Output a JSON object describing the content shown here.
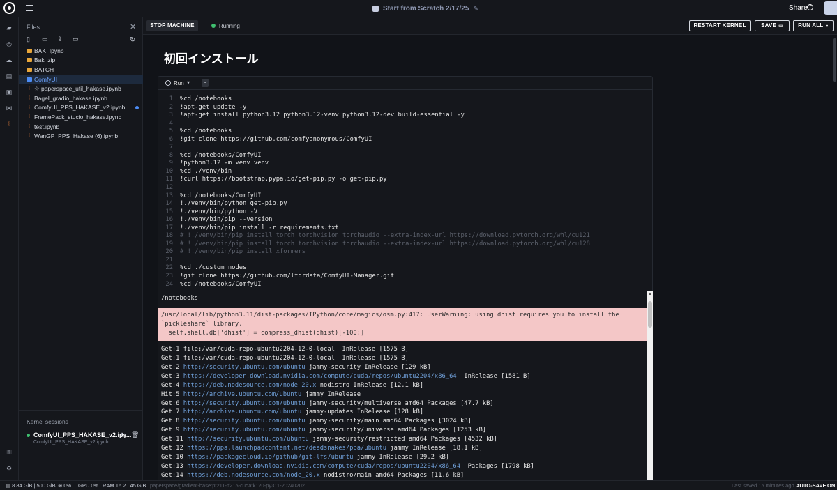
{
  "topbar": {
    "title": "Start from Scratch 2/17/25",
    "share_label": "Share",
    "help_glyph": "?"
  },
  "rail_icons": [
    "folder-icon",
    "globe-icon",
    "cloud-icon",
    "notebook-icon",
    "terminal-icon",
    "vscode-icon",
    "jupyter-icon"
  ],
  "files": {
    "header": "Files",
    "items": [
      {
        "label": "BAK_Ipynb",
        "type": "folder"
      },
      {
        "label": "Bak_zip",
        "type": "folder"
      },
      {
        "label": "BATCH",
        "type": "folder"
      },
      {
        "label": "ComfyUI",
        "type": "folder",
        "active": true
      },
      {
        "label": "☆ paperspace_util_hakase.ipynb",
        "type": "notebook"
      },
      {
        "label": "Bagel_gradio_hakase.ipynb",
        "type": "notebook"
      },
      {
        "label": "ComfyUI_PPS_HAKASE_v2.ipynb",
        "type": "notebook",
        "modified": true
      },
      {
        "label": "FramePack_stucio_hakase.ipynb",
        "type": "notebook"
      },
      {
        "label": "test.ipynb",
        "type": "notebook"
      },
      {
        "label": "WanGP_PPS_Hakase (6).ipynb",
        "type": "notebook"
      }
    ]
  },
  "kernel_sessions": {
    "header": "Kernel sessions",
    "name": "ComfyUI_PPS_HAKASE_v2.ipy...",
    "file": "ComfyUI_PPS_HAKASE_v2.ipynb"
  },
  "toolbar": {
    "stop_label": "STOP MACHINE",
    "status": "Running",
    "restart_label": "RESTART KERNEL",
    "save_label": "SAVE",
    "run_all_label": "RUN ALL"
  },
  "notebook": {
    "title": "初回インストール",
    "run_label": "Run",
    "more_glyph": "⌄",
    "code": [
      {
        "n": "1",
        "text": "%cd /notebooks"
      },
      {
        "n": "2",
        "text": "!apt-get update -y"
      },
      {
        "n": "3",
        "text": "!apt-get install python3.12 python3.12-venv python3.12-dev build-essential -y"
      },
      {
        "n": "4",
        "text": ""
      },
      {
        "n": "5",
        "text": "%cd /notebooks"
      },
      {
        "n": "6",
        "text": "!git clone https://github.com/comfyanonymous/ComfyUI"
      },
      {
        "n": "7",
        "text": ""
      },
      {
        "n": "8",
        "text": "%cd /notebooks/ComfyUI"
      },
      {
        "n": "9",
        "text": "!python3.12 -m venv venv"
      },
      {
        "n": "10",
        "text": "%cd ./venv/bin"
      },
      {
        "n": "11",
        "text": "!curl https://bootstrap.pypa.io/get-pip.py -o get-pip.py"
      },
      {
        "n": "12",
        "text": ""
      },
      {
        "n": "13",
        "text": "%cd /notebooks/ComfyUI"
      },
      {
        "n": "14",
        "text": "!./venv/bin/python get-pip.py"
      },
      {
        "n": "15",
        "text": "!./venv/bin/python -V"
      },
      {
        "n": "16",
        "text": "!./venv/bin/pip --version"
      },
      {
        "n": "17",
        "text": "!./venv/bin/pip install -r requirements.txt"
      },
      {
        "n": "18",
        "text": "# !./venv/bin/pip install torch torchvision torchaudio --extra-index-url https://download.pytorch.org/whl/cu121",
        "comment": true
      },
      {
        "n": "19",
        "text": "# !./venv/bin/pip install torch torchvision torchaudio --extra-index-url https://download.pytorch.org/whl/cu128",
        "comment": true
      },
      {
        "n": "20",
        "text": "# !./venv/bin/pip install xformers",
        "comment": true
      },
      {
        "n": "21",
        "text": ""
      },
      {
        "n": "22",
        "text": "%cd ./custom_nodes"
      },
      {
        "n": "23",
        "text": "!git clone https://github.com/ltdrdata/ComfyUI-Manager.git"
      },
      {
        "n": "24",
        "text": "%cd /notebooks/ComfyUI"
      }
    ],
    "output_first": "/notebooks",
    "warning": [
      "/usr/local/lib/python3.11/dist-packages/IPython/core/magics/osm.py:417: UserWarning: using dhist requires you to install the",
      "`pickleshare` library.",
      "  self.shell.db['dhist'] = compress_dhist(dhist)[-100:]"
    ],
    "output": [
      {
        "pre": "Get:1 file:/var/cuda-repo-ubuntu2204-12-0-local  InRelease [1575 B]",
        "url": "",
        "post": ""
      },
      {
        "pre": "Get:1 file:/var/cuda-repo-ubuntu2204-12-0-local  InRelease [1575 B]",
        "url": "",
        "post": ""
      },
      {
        "pre": "Get:2 ",
        "url": "http://security.ubuntu.com/ubuntu",
        "post": " jammy-security InRelease [129 kB]"
      },
      {
        "pre": "Get:3 ",
        "url": "https://developer.download.nvidia.com/compute/cuda/repos/ubuntu2204/x86_64",
        "post": "  InRelease [1581 B]"
      },
      {
        "pre": "Get:4 ",
        "url": "https://deb.nodesource.com/node_20.x",
        "post": " nodistro InRelease [12.1 kB]"
      },
      {
        "pre": "Hit:5 ",
        "url": "http://archive.ubuntu.com/ubuntu",
        "post": " jammy InRelease"
      },
      {
        "pre": "Get:6 ",
        "url": "http://security.ubuntu.com/ubuntu",
        "post": " jammy-security/multiverse amd64 Packages [47.7 kB]"
      },
      {
        "pre": "Get:7 ",
        "url": "http://archive.ubuntu.com/ubuntu",
        "post": " jammy-updates InRelease [128 kB]"
      },
      {
        "pre": "Get:8 ",
        "url": "http://security.ubuntu.com/ubuntu",
        "post": " jammy-security/main amd64 Packages [3024 kB]"
      },
      {
        "pre": "Get:9 ",
        "url": "http://security.ubuntu.com/ubuntu",
        "post": " jammy-security/universe amd64 Packages [1253 kB]"
      },
      {
        "pre": "Get:11 ",
        "url": "http://security.ubuntu.com/ubuntu",
        "post": " jammy-security/restricted amd64 Packages [4532 kB]"
      },
      {
        "pre": "Get:12 ",
        "url": "https://ppa.launchpadcontent.net/deadsnakes/ppa/ubuntu",
        "post": " jammy InRelease [18.1 kB]"
      },
      {
        "pre": "Get:10 ",
        "url": "https://packagecloud.io/github/git-lfs/ubuntu",
        "post": " jammy InRelease [29.2 kB]"
      },
      {
        "pre": "Get:13 ",
        "url": "https://developer.download.nvidia.com/compute/cuda/repos/ubuntu2204/x86_64",
        "post": "  Packages [1798 kB]"
      },
      {
        "pre": "Get:14 ",
        "url": "https://deb.nodesource.com/node_20.x",
        "post": " nodistro/main amd64 Packages [11.6 kB]"
      }
    ]
  },
  "statusbar": {
    "storage": "8.84 GiB | 500 GiB",
    "cpu": "0%",
    "gpu_label": "GPU",
    "gpu": "0%",
    "ram_label": "RAM",
    "ram": "16.2 | 45 GiB",
    "image": "paperspace/gradient-base:pt211-tf215-cudatk120-py311-20240202",
    "last_saved": "Last saved 15 minutes ago",
    "autosave_label": "AUTO-SAVE",
    "autosave_state": "ON"
  },
  "colors": {
    "accent": "#4c8cf5",
    "running": "#3fbf6f",
    "warning_bg": "#f4c7c7",
    "folder": "#e8a63a"
  }
}
